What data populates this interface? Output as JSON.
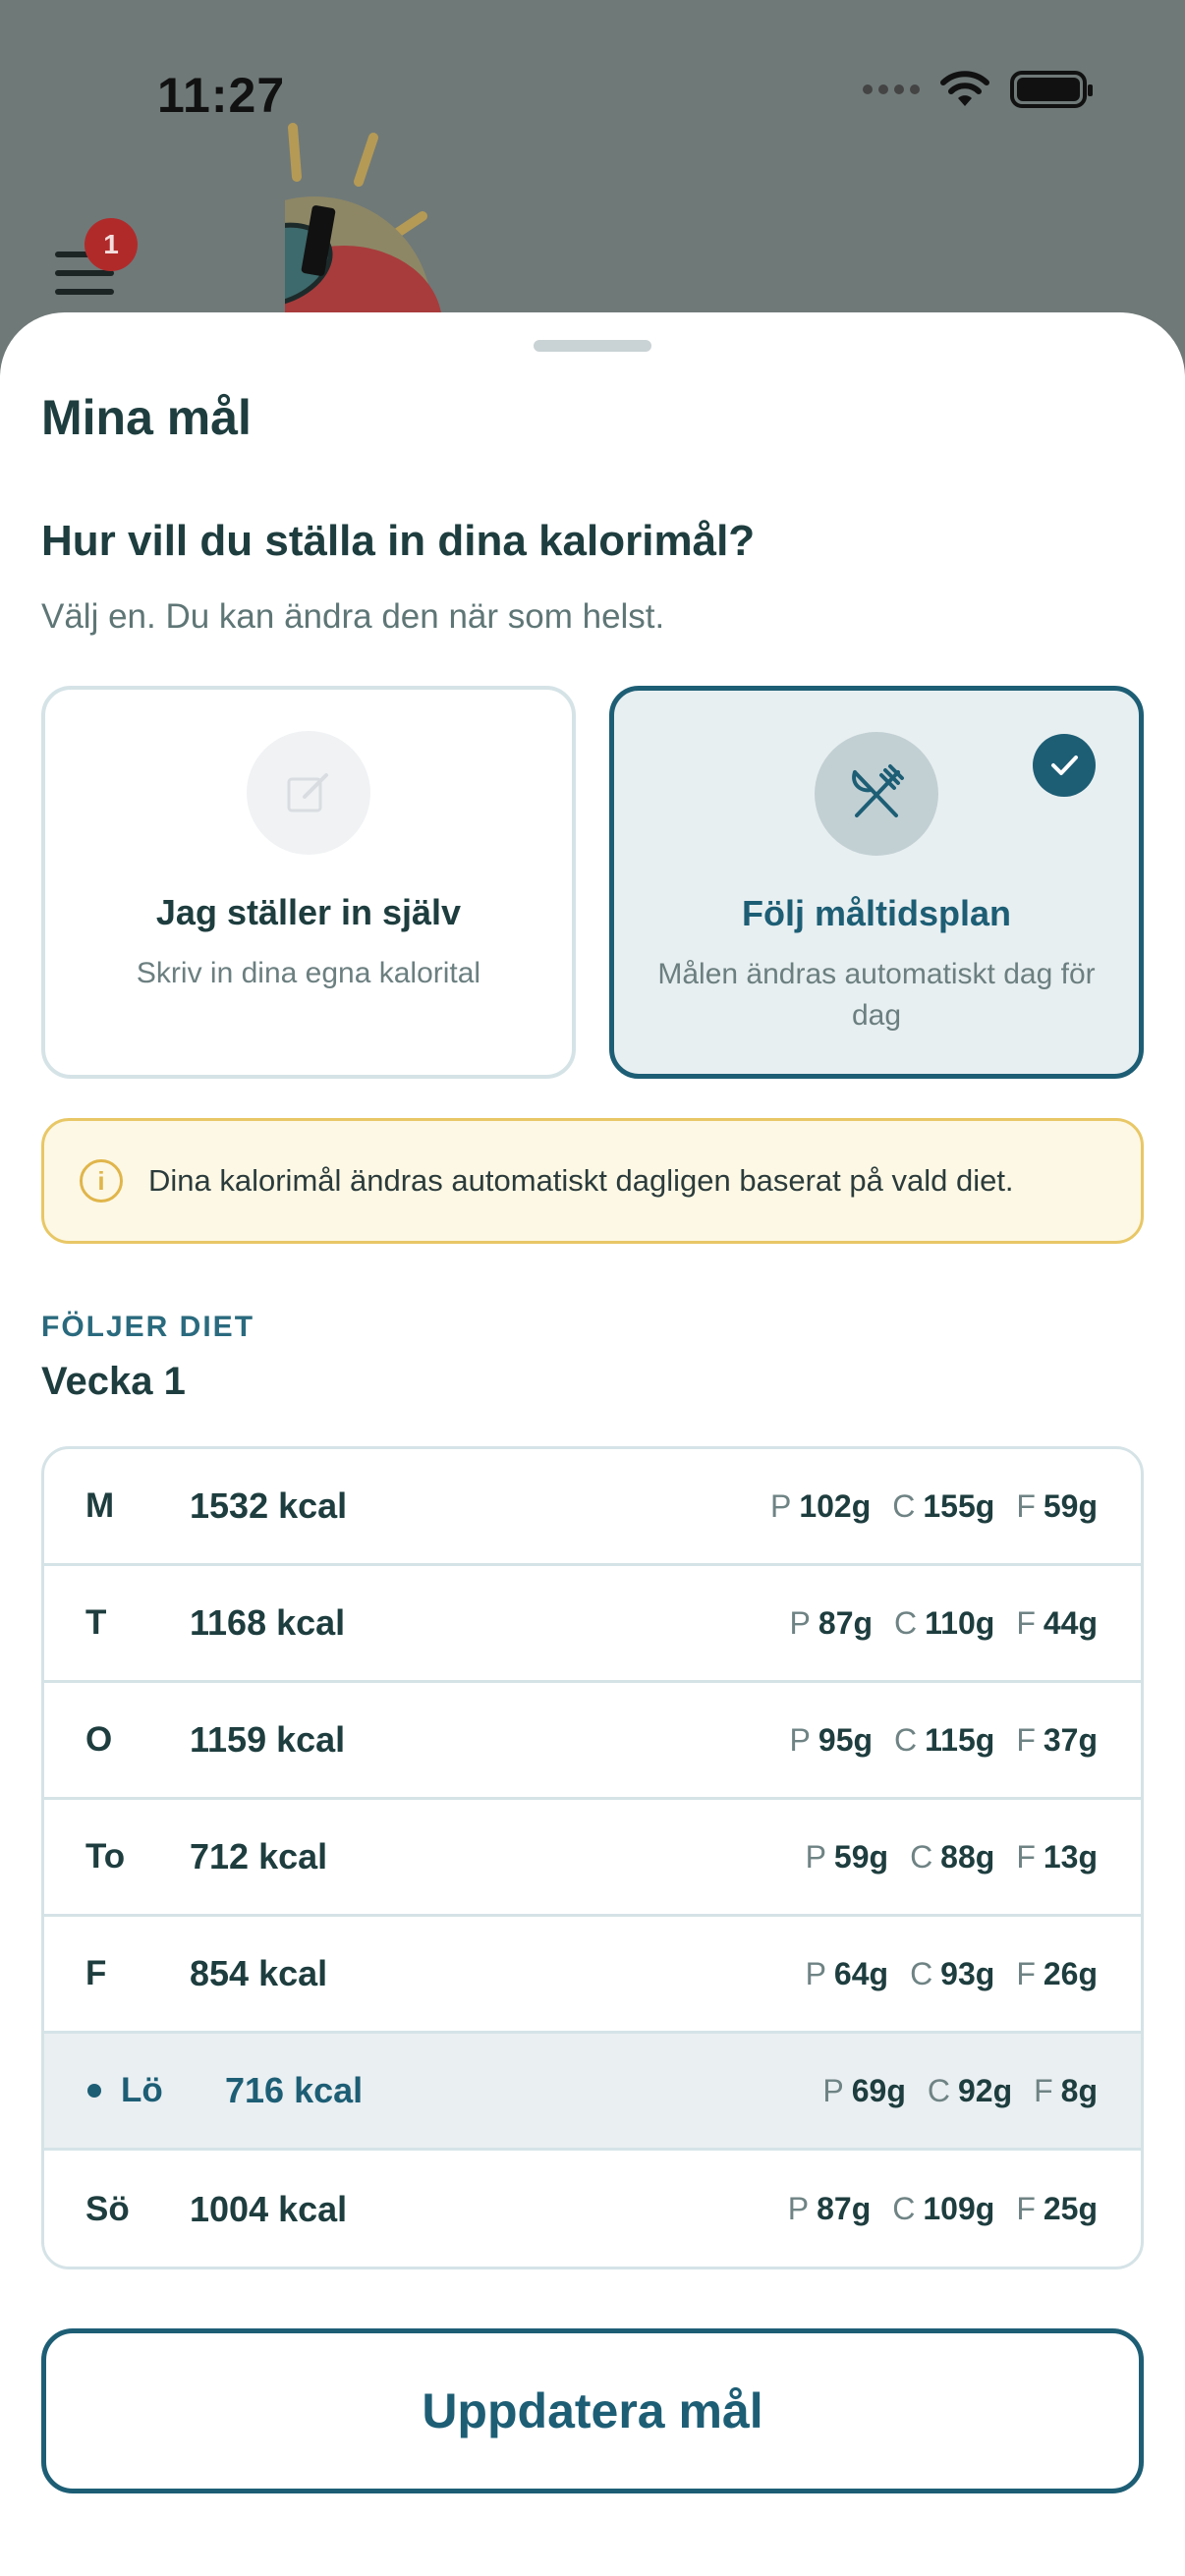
{
  "status_bar": {
    "time": "11:27"
  },
  "menu": {
    "badge_count": "1"
  },
  "sheet": {
    "title": "Mina mål",
    "question": "Hur vill du ställa in dina kalorimål?",
    "subtitle": "Välj en. Du kan ändra den när som helst."
  },
  "options": {
    "manual": {
      "title": "Jag ställer in själv",
      "description": "Skriv in dina egna kalorital",
      "icon": "edit-icon",
      "selected": false
    },
    "plan": {
      "title": "Följ måltidsplan",
      "description": "Målen ändras automatiskt dag för dag",
      "icon": "fork-knife-icon",
      "selected": true
    }
  },
  "info": {
    "text": "Dina kalorimål ändras automatiskt dagligen baserat på vald diet."
  },
  "diet": {
    "label": "FÖLJER DIET",
    "week": "Vecka 1",
    "days": [
      {
        "day": "M",
        "kcal": "1532 kcal",
        "p": "102g",
        "c": "155g",
        "f": "59g"
      },
      {
        "day": "T",
        "kcal": "1168 kcal",
        "p": "87g",
        "c": "110g",
        "f": "44g"
      },
      {
        "day": "O",
        "kcal": "1159 kcal",
        "p": "95g",
        "c": "115g",
        "f": "37g"
      },
      {
        "day": "To",
        "kcal": "712 kcal",
        "p": "59g",
        "c": "88g",
        "f": "13g"
      },
      {
        "day": "F",
        "kcal": "854 kcal",
        "p": "64g",
        "c": "93g",
        "f": "26g"
      },
      {
        "day": "Lö",
        "kcal": "716 kcal",
        "p": "69g",
        "c": "92g",
        "f": "8g",
        "today": true
      },
      {
        "day": "Sö",
        "kcal": "1004 kcal",
        "p": "87g",
        "c": "109g",
        "f": "25g"
      }
    ],
    "macro_labels": {
      "p": "P",
      "c": "C",
      "f": "F"
    }
  },
  "update_button": {
    "label": "Uppdatera mål"
  },
  "colors": {
    "accent": "#1d5e75",
    "info_border": "#e8c766",
    "info_bg": "#fdf8e5"
  }
}
